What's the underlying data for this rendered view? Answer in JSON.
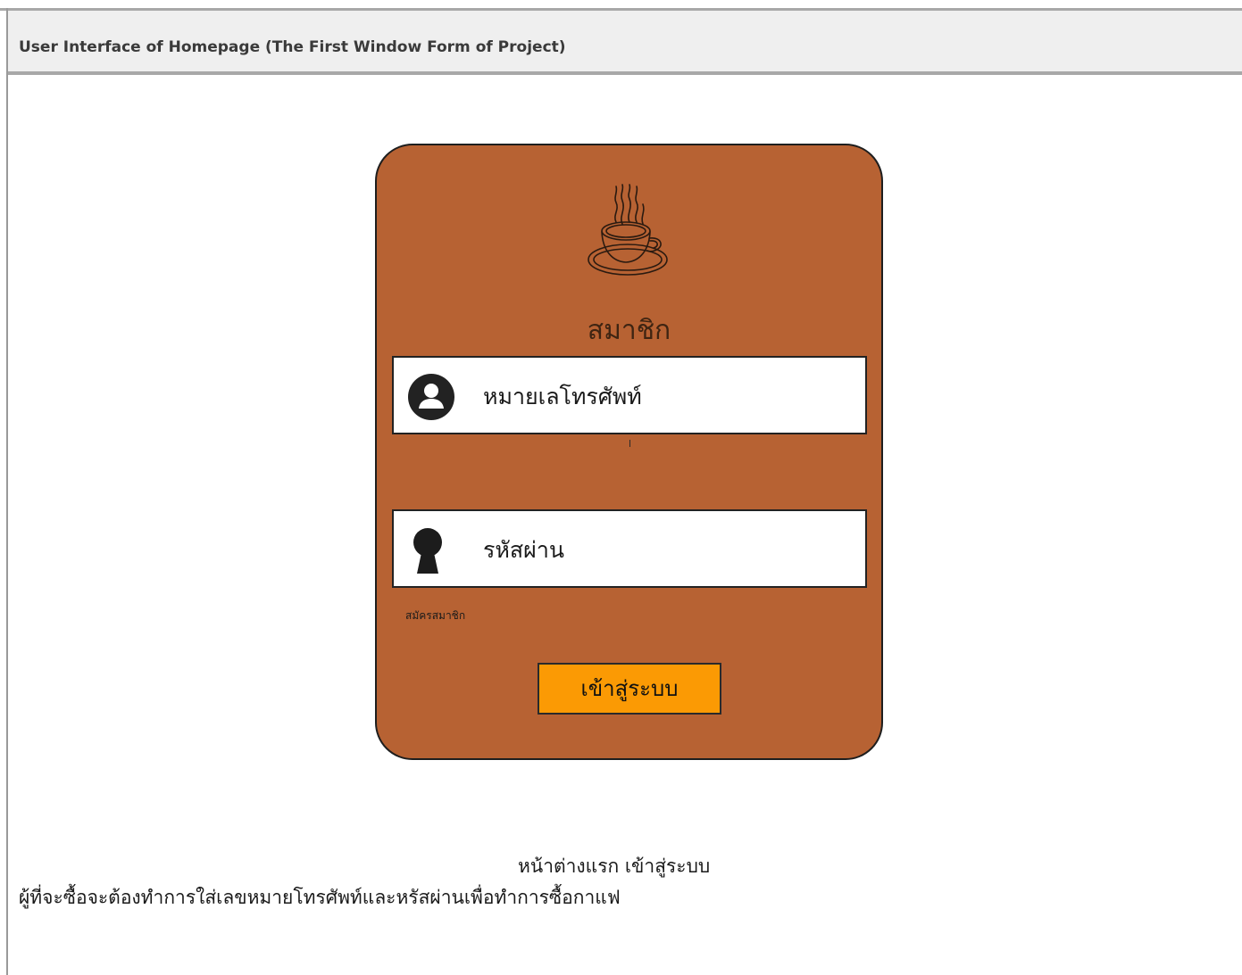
{
  "header": {
    "title": "User Interface of Homepage (The First Window Form of Project)"
  },
  "login_card": {
    "logo_icon": "coffee-cup-icon",
    "title": "สมาชิก",
    "phone_field": {
      "label": "หมายเลโทรศัพท์",
      "icon": "user-icon"
    },
    "password_field": {
      "label": "รหัสผ่าน",
      "icon": "keyhole-icon"
    },
    "register_link": "สมัครสมาชิก",
    "login_button": "เข้าสู่ระบบ",
    "colors": {
      "card_background": "#b76233",
      "button_background": "#fb9a04",
      "title_color": "#3e2412"
    }
  },
  "captions": {
    "line1": "หน้าต่างแรก เข้าสู่ระบบ",
    "line2": "ผู้ที่จะซื้อจะต้องทำการใส่เลขหมายโทรศัพท์และหรัสผ่านเพื่อทำการซื้อกาแฟ"
  }
}
